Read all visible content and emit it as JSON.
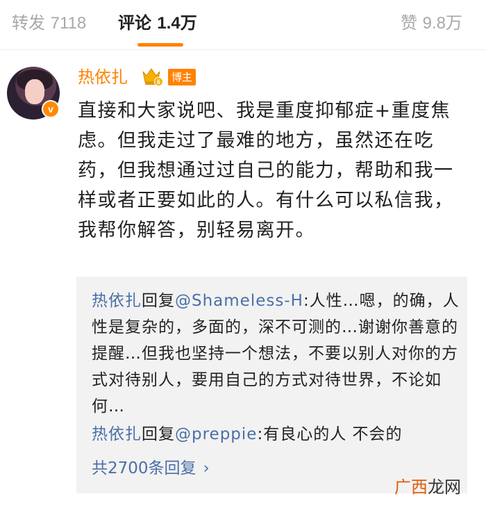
{
  "tabs": {
    "repost": {
      "label": "转发",
      "count": "7118"
    },
    "comment": {
      "label": "评论",
      "count": "1.4万"
    },
    "like": {
      "label": "赞",
      "count": "9.8万"
    }
  },
  "comment": {
    "username": "热依扎",
    "crown_level": "6",
    "author_tag": "博主",
    "verified_mark": "v",
    "text": "直接和大家说吧、我是重度抑郁症+重度焦虑。但我走过了最难的地方，虽然还在吃药，但我想通过过自己的能力，帮助和我一样或者正要如此的人。有什么可以私信我，我帮你解答，别轻易离开。"
  },
  "replies": [
    {
      "author": "热依扎",
      "action": "回复",
      "mention": "@Shameless-H",
      "text": ":人性…嗯，的确，人性是复杂的，多面的，深不可测的…谢谢你善意的提醒…但我也坚持一个想法，不要以别人对你的方式对待别人，要用自己的方式对待世界，不论如何…"
    },
    {
      "author": "热依扎",
      "action": "回复",
      "mention": "@preppie",
      "text": ":有良心的人 不会的"
    }
  ],
  "more_replies": {
    "label": "共2700条回复",
    "arrow": "›"
  },
  "watermark": {
    "part1": "广西",
    "part2": "龙网"
  },
  "colors": {
    "accent": "#ff8200",
    "link": "#4a6fa8",
    "reply_bg": "#f2f2f2"
  }
}
